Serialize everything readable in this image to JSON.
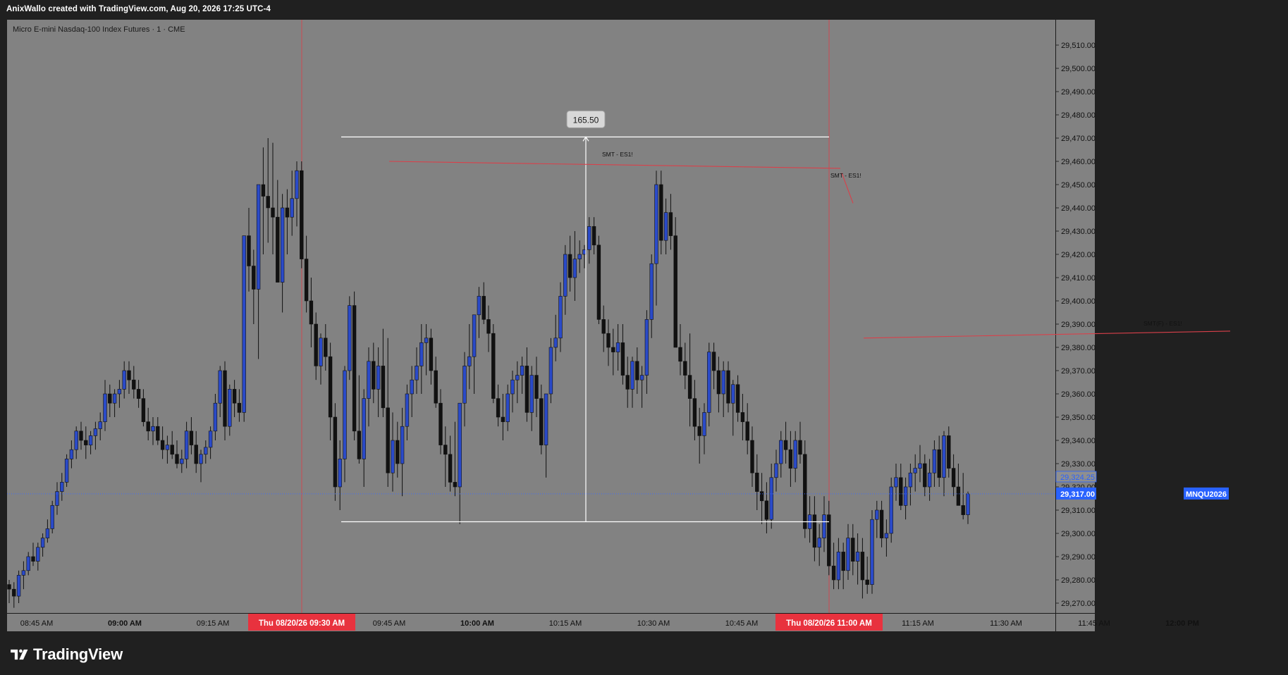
{
  "header": {
    "attribution": "AnixWallo created with TradingView.com, Aug 20, 2026 17:25 UTC-4",
    "symbol_title": "Micro E-mini Nasdaq-100 Index Futures · 1 · CME"
  },
  "footer": {
    "brand": "TradingView"
  },
  "colors": {
    "pane_bg": "#828282",
    "outer_bg": "#202020",
    "up_candle": "#2a4ac8",
    "down_candle": "#111111",
    "session_line": "#d9404a",
    "badge_red": "#e8323e",
    "price_blue": "#2962ff",
    "measure_white": "#ffffff"
  },
  "measurement": {
    "label": "165.50",
    "high": 29470.5,
    "low": 29305.0
  },
  "annotations": [
    {
      "text": "SMT - ES1!",
      "kind": "label",
      "anchor_time": "10:15 AM"
    },
    {
      "text": "SMT - ES1!",
      "kind": "label",
      "anchor_time": "11:00 AM"
    },
    {
      "text": "SMT(F) - ES1!",
      "kind": "label",
      "anchor_time": "12:00 PM"
    }
  ],
  "time_badges": [
    "Thu 08/20/26   09:30 AM",
    "Thu 08/20/26   11:00 AM"
  ],
  "price_badges": {
    "symbol": "MNQU2026",
    "last_price": "29,317.00",
    "ghost_price": "29,324.25"
  },
  "chart_data": {
    "type": "candlestick",
    "title": "Micro E-mini Nasdaq-100 Index Futures · 1 · CME",
    "interval": "1 minute",
    "y_ticks": [
      "29,270.00",
      "29,280.00",
      "29,290.00",
      "29,300.00",
      "29,310.00",
      "29,320.00",
      "29,330.00",
      "29,340.00",
      "29,350.00",
      "29,360.00",
      "29,370.00",
      "29,380.00",
      "29,390.00",
      "29,400.00",
      "29,410.00",
      "29,420.00",
      "29,430.00",
      "29,440.00",
      "29,450.00",
      "29,460.00",
      "29,470.00",
      "29,480.00",
      "29,490.00",
      "29,500.00",
      "29,510.00"
    ],
    "x_ticks": [
      {
        "label": "08:45 AM",
        "bold": false
      },
      {
        "label": "09:00 AM",
        "bold": true
      },
      {
        "label": "09:15 AM",
        "bold": false
      },
      {
        "label": "09:45 AM",
        "bold": false
      },
      {
        "label": "10:00 AM",
        "bold": true
      },
      {
        "label": "10:15 AM",
        "bold": false
      },
      {
        "label": "10:30 AM",
        "bold": false
      },
      {
        "label": "10:45 AM",
        "bold": false
      },
      {
        "label": "11:15 AM",
        "bold": false
      },
      {
        "label": "11:30 AM",
        "bold": false
      },
      {
        "label": "11:45 AM",
        "bold": false
      },
      {
        "label": "12:00 PM",
        "bold": true
      }
    ],
    "ylim": [
      29264,
      29518
    ],
    "session_markers": [
      "09:30 AM",
      "11:00 AM"
    ],
    "last_price": 29317.0,
    "grid": false,
    "ohlc": [
      [
        29278,
        29280,
        29270,
        29276
      ],
      [
        29276,
        29279,
        29268,
        29273
      ],
      [
        29273,
        29284,
        29270,
        29282
      ],
      [
        29282,
        29288,
        29276,
        29284
      ],
      [
        29284,
        29292,
        29282,
        29290
      ],
      [
        29290,
        29296,
        29286,
        29288
      ],
      [
        29288,
        29296,
        29284,
        29294
      ],
      [
        29294,
        29300,
        29290,
        29298
      ],
      [
        29298,
        29306,
        29296,
        29302
      ],
      [
        29302,
        29314,
        29300,
        29312
      ],
      [
        29312,
        29322,
        29308,
        29318
      ],
      [
        29318,
        29326,
        29314,
        29322
      ],
      [
        29322,
        29334,
        29320,
        29332
      ],
      [
        29332,
        29340,
        29328,
        29336
      ],
      [
        29336,
        29346,
        29332,
        29344
      ],
      [
        29344,
        29348,
        29336,
        29340
      ],
      [
        29340,
        29346,
        29332,
        29338
      ],
      [
        29338,
        29344,
        29334,
        29342
      ],
      [
        29342,
        29348,
        29336,
        29345
      ],
      [
        29345,
        29352,
        29340,
        29348
      ],
      [
        29348,
        29366,
        29344,
        29360
      ],
      [
        29360,
        29364,
        29350,
        29356
      ],
      [
        29356,
        29362,
        29350,
        29360
      ],
      [
        29360,
        29366,
        29354,
        29362
      ],
      [
        29362,
        29374,
        29358,
        29370
      ],
      [
        29370,
        29374,
        29360,
        29366
      ],
      [
        29366,
        29372,
        29358,
        29362
      ],
      [
        29362,
        29366,
        29354,
        29358
      ],
      [
        29358,
        29362,
        29346,
        29348
      ],
      [
        29348,
        29354,
        29340,
        29344
      ],
      [
        29344,
        29350,
        29338,
        29346
      ],
      [
        29346,
        29350,
        29338,
        29340
      ],
      [
        29340,
        29346,
        29332,
        29336
      ],
      [
        29336,
        29342,
        29330,
        29338
      ],
      [
        29338,
        29344,
        29332,
        29334
      ],
      [
        29334,
        29340,
        29328,
        29330
      ],
      [
        29330,
        29336,
        29326,
        29332
      ],
      [
        29332,
        29348,
        29328,
        29344
      ],
      [
        29344,
        29350,
        29334,
        29338
      ],
      [
        29338,
        29344,
        29326,
        29330
      ],
      [
        29330,
        29336,
        29322,
        29334
      ],
      [
        29334,
        29340,
        29330,
        29337
      ],
      [
        29337,
        29346,
        29332,
        29344
      ],
      [
        29344,
        29360,
        29340,
        29356
      ],
      [
        29356,
        29372,
        29350,
        29370
      ],
      [
        29370,
        29374,
        29340,
        29346
      ],
      [
        29346,
        29364,
        29342,
        29362
      ],
      [
        29362,
        29366,
        29350,
        29356
      ],
      [
        29356,
        29362,
        29348,
        29352
      ],
      [
        29352,
        29400,
        29348,
        29428
      ],
      [
        29428,
        29440,
        29404,
        29415
      ],
      [
        29415,
        29422,
        29390,
        29405
      ],
      [
        29405,
        29450,
        29375,
        29450
      ],
      [
        29450,
        29466,
        29420,
        29445
      ],
      [
        29445,
        29470,
        29425,
        29440
      ],
      [
        29440,
        29468,
        29420,
        29436
      ],
      [
        29436,
        29452,
        29414,
        29408
      ],
      [
        29408,
        29446,
        29395,
        29440
      ],
      [
        29440,
        29448,
        29420,
        29436
      ],
      [
        29436,
        29456,
        29428,
        29444
      ],
      [
        29444,
        29460,
        29432,
        29456
      ],
      [
        29456,
        29460,
        29414,
        29418
      ],
      [
        29418,
        29428,
        29395,
        29400
      ],
      [
        29400,
        29410,
        29380,
        29390
      ],
      [
        29390,
        29395,
        29366,
        29372
      ],
      [
        29372,
        29386,
        29364,
        29384
      ],
      [
        29384,
        29390,
        29370,
        29376
      ],
      [
        29376,
        29382,
        29340,
        29350
      ],
      [
        29350,
        29356,
        29314,
        29320
      ],
      [
        29320,
        29340,
        29310,
        29332
      ],
      [
        29332,
        29372,
        29322,
        29370
      ],
      [
        29370,
        29402,
        29366,
        29398
      ],
      [
        29398,
        29404,
        29340,
        29344
      ],
      [
        29344,
        29368,
        29330,
        29332
      ],
      [
        29332,
        29362,
        29320,
        29358
      ],
      [
        29358,
        29380,
        29346,
        29374
      ],
      [
        29374,
        29382,
        29356,
        29362
      ],
      [
        29362,
        29380,
        29350,
        29372
      ],
      [
        29372,
        29388,
        29350,
        29354
      ],
      [
        29354,
        29384,
        29320,
        29326
      ],
      [
        29326,
        29352,
        29318,
        29340
      ],
      [
        29340,
        29348,
        29324,
        29330
      ],
      [
        29330,
        29354,
        29316,
        29346
      ],
      [
        29346,
        29364,
        29340,
        29360
      ],
      [
        29360,
        29372,
        29350,
        29366
      ],
      [
        29366,
        29380,
        29360,
        29372
      ],
      [
        29372,
        29390,
        29360,
        29382
      ],
      [
        29382,
        29390,
        29368,
        29384
      ],
      [
        29384,
        29388,
        29364,
        29370
      ],
      [
        29370,
        29376,
        29354,
        29356
      ],
      [
        29356,
        29362,
        29334,
        29338
      ],
      [
        29338,
        29346,
        29320,
        29334
      ],
      [
        29334,
        29342,
        29318,
        29322
      ],
      [
        29322,
        29348,
        29316,
        29320
      ],
      [
        29320,
        29352,
        29304,
        29356
      ],
      [
        29356,
        29378,
        29346,
        29372
      ],
      [
        29372,
        29390,
        29362,
        29376
      ],
      [
        29376,
        29394,
        29360,
        29394
      ],
      [
        29394,
        29406,
        29384,
        29402
      ],
      [
        29402,
        29408,
        29390,
        29392
      ],
      [
        29392,
        29398,
        29378,
        29386
      ],
      [
        29386,
        29390,
        29356,
        29358
      ],
      [
        29358,
        29364,
        29346,
        29350
      ],
      [
        29350,
        29360,
        29340,
        29348
      ],
      [
        29348,
        29364,
        29344,
        29360
      ],
      [
        29360,
        29370,
        29352,
        29366
      ],
      [
        29366,
        29374,
        29356,
        29368
      ],
      [
        29368,
        29376,
        29360,
        29372
      ],
      [
        29372,
        29380,
        29348,
        29352
      ],
      [
        29352,
        29372,
        29344,
        29368
      ],
      [
        29368,
        29376,
        29350,
        29358
      ],
      [
        29358,
        29364,
        29334,
        29338
      ],
      [
        29338,
        29344,
        29324,
        29360
      ],
      [
        29360,
        29384,
        29356,
        29380
      ],
      [
        29380,
        29394,
        29374,
        29384
      ],
      [
        29384,
        29408,
        29378,
        29402
      ],
      [
        29402,
        29424,
        29394,
        29420
      ],
      [
        29420,
        29428,
        29404,
        29410
      ],
      [
        29410,
        29430,
        29400,
        29418
      ],
      [
        29418,
        29426,
        29412,
        29420
      ],
      [
        29420,
        29424,
        29414,
        29422
      ],
      [
        29422,
        29436,
        29416,
        29432
      ],
      [
        29432,
        29436,
        29420,
        29424
      ],
      [
        29424,
        29428,
        29390,
        29392
      ],
      [
        29392,
        29398,
        29378,
        29386
      ],
      [
        29386,
        29392,
        29372,
        29380
      ],
      [
        29380,
        29388,
        29368,
        29378
      ],
      [
        29378,
        29390,
        29370,
        29382
      ],
      [
        29382,
        29390,
        29364,
        29368
      ],
      [
        29368,
        29376,
        29354,
        29362
      ],
      [
        29362,
        29376,
        29354,
        29374
      ],
      [
        29374,
        29380,
        29360,
        29366
      ],
      [
        29366,
        29372,
        29354,
        29368
      ],
      [
        29368,
        29396,
        29360,
        29392
      ],
      [
        29392,
        29420,
        29384,
        29416
      ],
      [
        29416,
        29456,
        29398,
        29450
      ],
      [
        29450,
        29456,
        29420,
        29426
      ],
      [
        29426,
        29444,
        29420,
        29438
      ],
      [
        29438,
        29446,
        29422,
        29428
      ],
      [
        29428,
        29436,
        29400,
        29380
      ],
      [
        29380,
        29390,
        29368,
        29374
      ],
      [
        29374,
        29382,
        29362,
        29368
      ],
      [
        29368,
        29386,
        29346,
        29358
      ],
      [
        29358,
        29366,
        29340,
        29346
      ],
      [
        29346,
        29354,
        29330,
        29342
      ],
      [
        29342,
        29356,
        29334,
        29352
      ],
      [
        29352,
        29382,
        29346,
        29378
      ],
      [
        29378,
        29382,
        29362,
        29370
      ],
      [
        29370,
        29376,
        29352,
        29360
      ],
      [
        29360,
        29374,
        29350,
        29370
      ],
      [
        29370,
        29374,
        29352,
        29356
      ],
      [
        29356,
        29366,
        29342,
        29364
      ],
      [
        29364,
        29368,
        29348,
        29352
      ],
      [
        29352,
        29360,
        29340,
        29348
      ],
      [
        29348,
        29356,
        29334,
        29340
      ],
      [
        29340,
        29346,
        29320,
        29326
      ],
      [
        29326,
        29334,
        29310,
        29318
      ],
      [
        29318,
        29326,
        29304,
        29314
      ],
      [
        29314,
        29322,
        29300,
        29306
      ],
      [
        29306,
        29330,
        29302,
        29324
      ],
      [
        29324,
        29336,
        29318,
        29330
      ],
      [
        29330,
        29344,
        29324,
        29340
      ],
      [
        29340,
        29348,
        29330,
        29336
      ],
      [
        29336,
        29344,
        29320,
        29328
      ],
      [
        29328,
        29344,
        29322,
        29340
      ],
      [
        29340,
        29348,
        29330,
        29334
      ],
      [
        29334,
        29340,
        29298,
        29302
      ],
      [
        29302,
        29316,
        29296,
        29308
      ],
      [
        29308,
        29316,
        29288,
        29294
      ],
      [
        29294,
        29304,
        29286,
        29298
      ],
      [
        29298,
        29316,
        29292,
        29308
      ],
      [
        29308,
        29314,
        29282,
        29286
      ],
      [
        29286,
        29296,
        29276,
        29280
      ],
      [
        29280,
        29298,
        29276,
        29292
      ],
      [
        29292,
        29296,
        29276,
        29284
      ],
      [
        29284,
        29304,
        29280,
        29298
      ],
      [
        29298,
        29304,
        29282,
        29288
      ],
      [
        29288,
        29300,
        29278,
        29292
      ],
      [
        29292,
        29298,
        29272,
        29280
      ],
      [
        29280,
        29290,
        29274,
        29278
      ],
      [
        29278,
        29310,
        29274,
        29306
      ],
      [
        29306,
        29314,
        29298,
        29310
      ],
      [
        29310,
        29314,
        29294,
        29298
      ],
      [
        29298,
        29306,
        29290,
        29300
      ],
      [
        29300,
        29324,
        29296,
        29320
      ],
      [
        29320,
        29330,
        29314,
        29324
      ],
      [
        29324,
        29330,
        29310,
        29312
      ],
      [
        29312,
        29324,
        29306,
        29320
      ],
      [
        29320,
        29330,
        29312,
        29326
      ],
      [
        29326,
        29334,
        29318,
        29328
      ],
      [
        29328,
        29338,
        29322,
        29330
      ],
      [
        29330,
        29334,
        29316,
        29320
      ],
      [
        29320,
        29332,
        29314,
        29326
      ],
      [
        29326,
        29340,
        29320,
        29336
      ],
      [
        29336,
        29342,
        29320,
        29324
      ],
      [
        29324,
        29344,
        29316,
        29342
      ],
      [
        29342,
        29346,
        29324,
        29328
      ],
      [
        29328,
        29334,
        29316,
        29320
      ],
      [
        29320,
        29330,
        29312,
        29312
      ],
      [
        29312,
        29326,
        29306,
        29308
      ],
      [
        29308,
        29318,
        29304,
        29317
      ]
    ]
  }
}
